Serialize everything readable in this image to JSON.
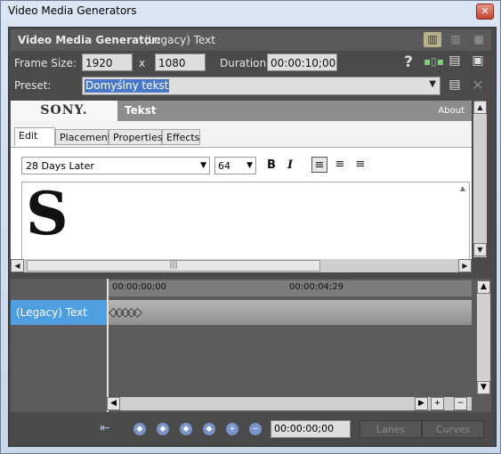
{
  "window": {
    "title": "Video Media Generators",
    "close": "✕"
  },
  "header": {
    "label": "Video Media Generator:",
    "value": "(Legacy) Text"
  },
  "frame": {
    "size_label": "Frame Size:",
    "width": "1920",
    "x": "x",
    "height": "1080",
    "duration_label": "Duration:",
    "duration": "00:00:10;00"
  },
  "preset": {
    "label": "Preset:",
    "value": "Domyślny tekst"
  },
  "plugin": {
    "brand": "SONY.",
    "title": "Tekst",
    "about": "About"
  },
  "tabs": [
    "Edit",
    "Placement",
    "Properties",
    "Effects"
  ],
  "text": {
    "font": "28 Days Later",
    "size": "64",
    "bold": "B",
    "italic": "I",
    "sample": "S"
  },
  "timeline": {
    "start_tc": "00:00:00;00",
    "mark_tc": "00:00:04;29",
    "track": "(Legacy) Text"
  },
  "bottom": {
    "timecode": "00:00:00;00",
    "lanes": "Lanes",
    "curves": "Curves"
  }
}
